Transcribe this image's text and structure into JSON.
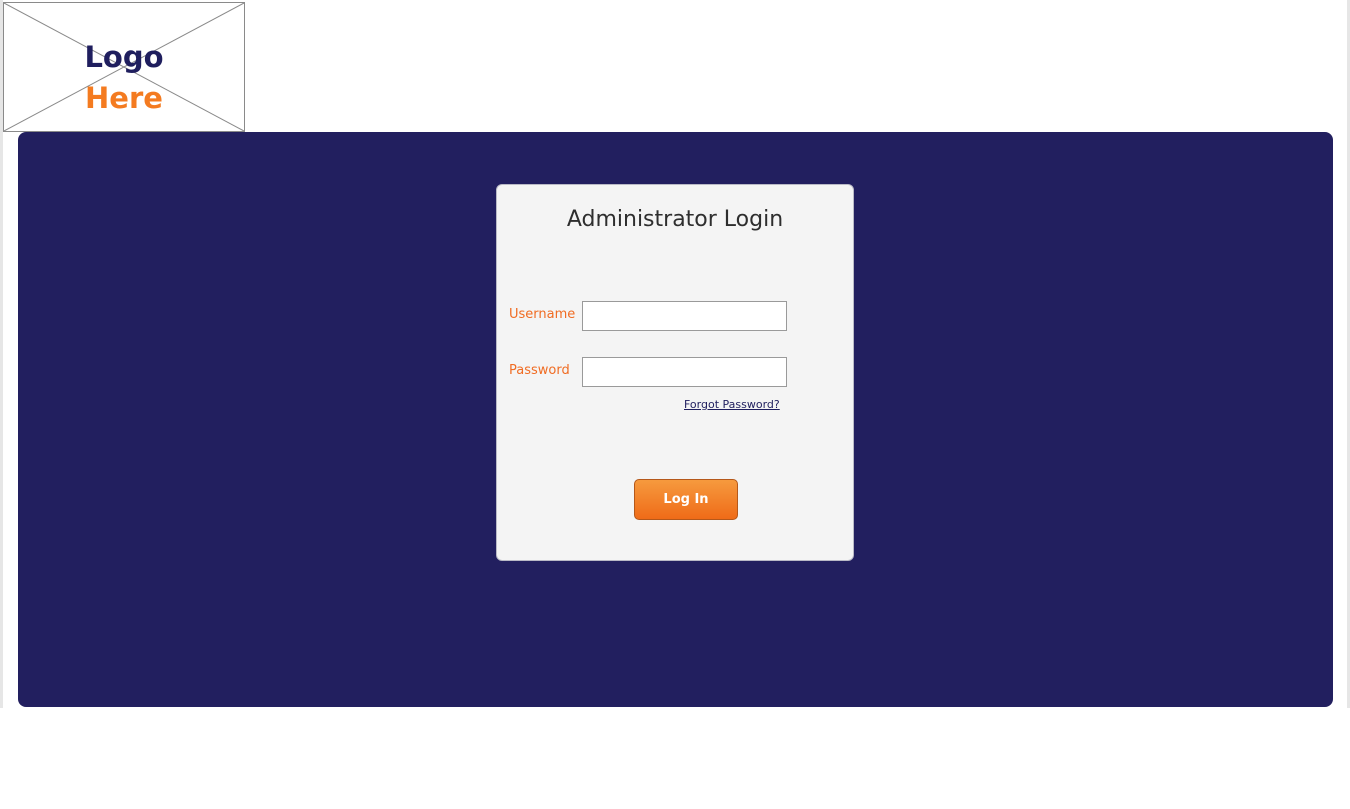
{
  "logo": {
    "line1": "Logo",
    "line2": "Here"
  },
  "login": {
    "title": "Administrator Login",
    "username_label": "Username",
    "username_value": "",
    "password_label": "Password",
    "password_value": "",
    "forgot_link": "Forgot Password?",
    "submit_label": "Log In"
  },
  "colors": {
    "panel_bg": "#221f5f",
    "card_bg": "#f4f4f4",
    "accent_orange": "#f47b20",
    "brand_navy": "#1f1e5e"
  }
}
